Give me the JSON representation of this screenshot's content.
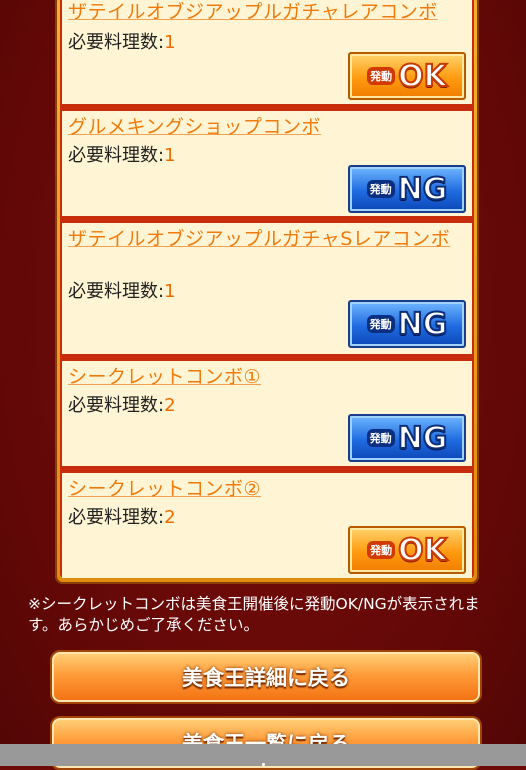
{
  "combos": [
    {
      "title": "ザテイルオブジアップルガチャレアコンボ",
      "req_label": "必要料理数:",
      "req_count": "1",
      "status": "OK"
    },
    {
      "title": "グルメキングショップコンボ",
      "req_label": "必要料理数:",
      "req_count": "1",
      "status": "NG"
    },
    {
      "title": "ザテイルオブジアップルガチャSレアコンボ",
      "req_label": "必要料理数:",
      "req_count": "1",
      "status": "NG"
    },
    {
      "title": "シークレットコンボ①",
      "req_label": "必要料理数:",
      "req_count": "2",
      "status": "NG"
    },
    {
      "title": "シークレットコンボ②",
      "req_label": "必要料理数:",
      "req_count": "2",
      "status": "OK"
    }
  ],
  "badge_prefix": "発動",
  "note": "※シークレットコンボは美食王開催後に発動OK/NGが表示されます。あらかじめご了承ください。",
  "buttons": {
    "back_detail": "美食王詳細に戻る",
    "back_list": "美食王一覧に戻る"
  },
  "colors": {
    "ok_orange": "#ff9a10",
    "ng_blue": "#1f6be0",
    "title_orange": "#f07a0c"
  }
}
